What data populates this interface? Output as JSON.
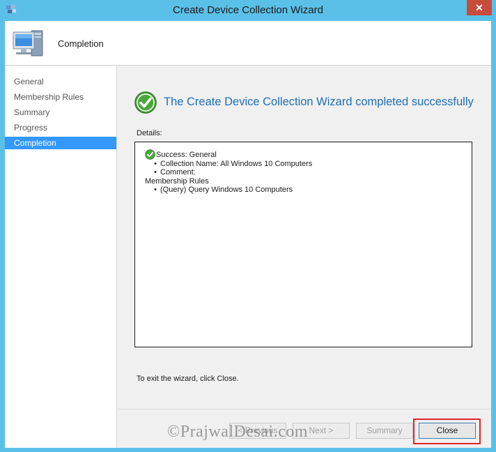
{
  "window": {
    "title": "Create Device Collection Wizard",
    "close_glyph": "✕",
    "icons": [
      "app-icon",
      "close-icon",
      "computer-icon",
      "check-icon"
    ]
  },
  "header": {
    "title": "Completion"
  },
  "sidebar": {
    "items": [
      {
        "label": "General",
        "active": false
      },
      {
        "label": "Membership Rules",
        "active": false
      },
      {
        "label": "Summary",
        "active": false
      },
      {
        "label": "Progress",
        "active": false
      },
      {
        "label": "Completion",
        "active": true
      }
    ]
  },
  "main": {
    "heading": "The Create Device Collection Wizard completed successfully",
    "details_label": "Details:",
    "details": {
      "success_line": "Success: General",
      "collection_name": "Collection Name: All Windows 10 Computers",
      "comment": "Comment:",
      "membership_header": "Membership Rules",
      "query_rule": "(Query) Query Windows 10 Computers"
    },
    "exit_text": "To exit the wizard, click Close."
  },
  "footer": {
    "previous": "< Previous",
    "next": "Next >",
    "summary": "Summary",
    "close": "Close"
  },
  "watermark": "©PrajwalDesai.com",
  "colors": {
    "frame": "#5bc0e8",
    "heading": "#1e6fb5",
    "selection": "#3399ff",
    "highlight": "#e0242b",
    "close_button": "#c74c3c"
  }
}
